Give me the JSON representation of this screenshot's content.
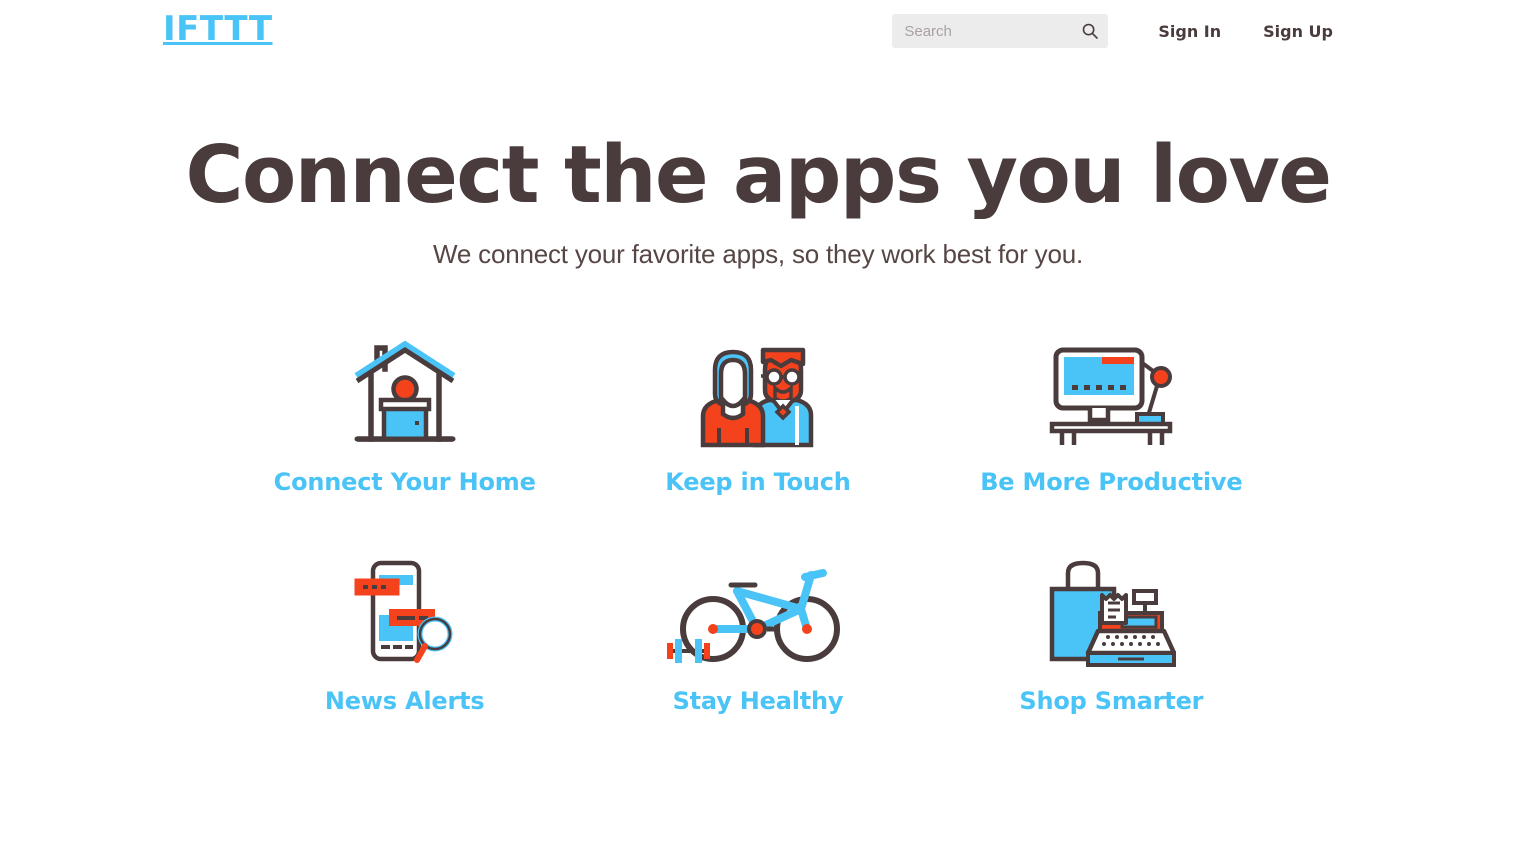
{
  "brand": {
    "logo_text": "IFTTT",
    "accent_blue": "#4ac3f7",
    "accent_orange": "#f4421c",
    "dark_brown": "#4a3c3c",
    "search_bg": "#ececec"
  },
  "header": {
    "search": {
      "placeholder": "Search",
      "value": "",
      "icon": "search-icon"
    },
    "sign_in_label": "Sign In",
    "sign_up_label": "Sign Up"
  },
  "hero": {
    "title": "Connect the apps you love",
    "subtitle": "We connect your favorite apps, so they work best for you."
  },
  "categories": [
    {
      "label": "Connect Your Home",
      "icon": "house-icon"
    },
    {
      "label": "Keep in Touch",
      "icon": "people-icon"
    },
    {
      "label": "Be More Productive",
      "icon": "desktop-icon"
    },
    {
      "label": "News Alerts",
      "icon": "phone-notification-icon"
    },
    {
      "label": "Stay Healthy",
      "icon": "bicycle-icon"
    },
    {
      "label": "Shop Smarter",
      "icon": "shopping-register-icon"
    }
  ]
}
